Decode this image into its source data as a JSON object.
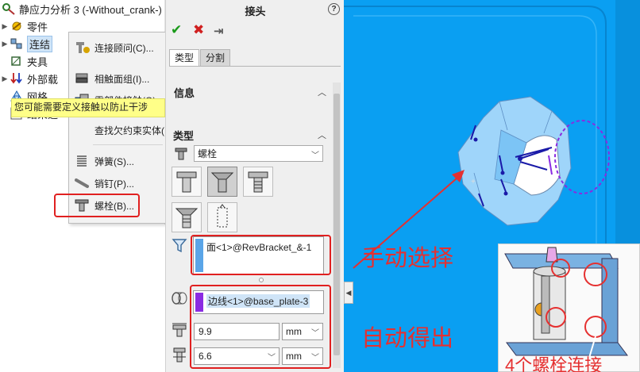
{
  "tree": {
    "title": "静应力分析 3 (-Without_crank-)",
    "items": [
      {
        "label": "零件",
        "icon": "parts-icon"
      },
      {
        "label": "连结",
        "icon": "connections-icon"
      },
      {
        "label": "夹具",
        "icon": "fixture-icon"
      },
      {
        "label": "外部载",
        "icon": "external-loads-icon"
      },
      {
        "label": "网格",
        "icon": "mesh-icon"
      },
      {
        "label": "结果选",
        "icon": "result-options-icon"
      }
    ]
  },
  "context_menu": {
    "items": [
      {
        "label": "连接顾问(C)...",
        "icon": "connection-advisor-icon"
      },
      {
        "label": "相触面组(I)...",
        "icon": "contact-set-icon"
      },
      {
        "label": "零部件接触(O)...",
        "icon": "component-contact-icon"
      },
      {
        "label": "查找欠约束实体(",
        "icon": ""
      },
      {
        "label": "弹簧(S)...",
        "icon": "spring-icon"
      },
      {
        "label": "销钉(P)...",
        "icon": "pin-icon"
      },
      {
        "label": "螺栓(B)...",
        "icon": "bolt-icon"
      }
    ]
  },
  "pm": {
    "title": "接头",
    "help": "?",
    "ok": "✔",
    "cancel": "✖",
    "pin": "⇥",
    "tabs": [
      "类型",
      "分割"
    ],
    "info_header": "信息",
    "info_text": "您可能需要定义接触以防止干涉",
    "type_header": "类型",
    "type_value": "螺栓",
    "face_selection": "面<1>@RevBracket_&-1",
    "edge_selection": "边线<1>@base_plate-3",
    "head_diameter": "9.9",
    "head_unit": "mm",
    "shank_diameter": "6.6",
    "shank_unit": "mm"
  },
  "annotations": {
    "manual": "手动选择",
    "auto": "自动得出",
    "inset_label": "4个螺栓连接"
  },
  "colors": {
    "model_blue": "#0a9ff2",
    "annotation_red": "#e53030",
    "selection_blue": "#5aa5e8",
    "selection_purple": "#8a2be2",
    "info_yellow": "#ffff88"
  }
}
